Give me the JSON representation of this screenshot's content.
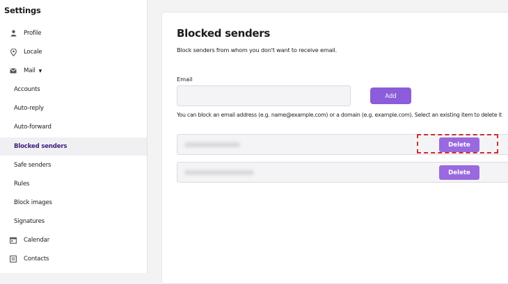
{
  "sidebar": {
    "title": "Settings",
    "items": [
      {
        "label": "Profile",
        "icon": "person-icon"
      },
      {
        "label": "Locale",
        "icon": "location-pin-icon"
      },
      {
        "label": "Mail",
        "icon": "mail-icon",
        "expanded": true
      },
      {
        "label": "Accounts"
      },
      {
        "label": "Auto-reply"
      },
      {
        "label": "Auto-forward"
      },
      {
        "label": "Blocked senders",
        "active": true
      },
      {
        "label": "Safe senders"
      },
      {
        "label": "Rules"
      },
      {
        "label": "Block images"
      },
      {
        "label": "Signatures"
      },
      {
        "label": "Calendar",
        "icon": "calendar-icon"
      },
      {
        "label": "Contacts",
        "icon": "contacts-icon"
      }
    ]
  },
  "main": {
    "title": "Blocked senders",
    "description": "Block senders from whom you don't want to receive email.",
    "email_label": "Email",
    "email_value": "",
    "add_label": "Add",
    "hint": "You can block an email address (e.g. name@example.com) or a domain (e.g. example.com). Select an existing item to delete it",
    "entries": [
      {
        "delete_label": "Delete",
        "highlighted": true
      },
      {
        "delete_label": "Delete",
        "highlighted": false
      }
    ]
  },
  "colors": {
    "accent": "#8b5ddb",
    "active_text": "#3b1d7a",
    "highlight": "#c8302f"
  }
}
